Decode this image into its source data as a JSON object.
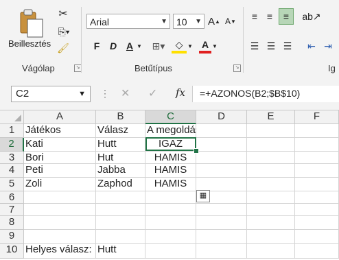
{
  "ribbon": {
    "paste_label": "Beillesztés",
    "font_name": "Arial",
    "font_size": "10",
    "bold": "F",
    "italic": "D",
    "underline": "A",
    "font_color_glyph": "A",
    "grow_font": "A",
    "shrink_font": "A",
    "group_clipboard": "Vágólap",
    "group_font": "Betűtípus",
    "group_align_partial": "Ig"
  },
  "formula_bar": {
    "name_box": "C2",
    "fx": "fx",
    "formula": "=+AZONOS(B2;$B$10)"
  },
  "sheet": {
    "columns": [
      "A",
      "B",
      "C",
      "D",
      "E",
      "F"
    ],
    "rows": [
      "1",
      "2",
      "3",
      "4",
      "5",
      "6",
      "7",
      "8",
      "9",
      "10"
    ],
    "cells": {
      "A1": "Játékos",
      "B1": "Válasz",
      "C1": "A megoldás",
      "A2": "Kati",
      "B2": "Hutt",
      "C2": "IGAZ",
      "A3": "Bori",
      "B3": "Hut",
      "C3": "HAMIS",
      "A4": "Peti",
      "B4": "Jabba",
      "C4": "HAMIS",
      "A5": "Zoli",
      "B5": "Zaphod",
      "C5": "HAMIS",
      "A10": "Helyes válasz:",
      "B10": "Hutt"
    },
    "selected_cell": "C2",
    "accent_color": "#217346"
  }
}
